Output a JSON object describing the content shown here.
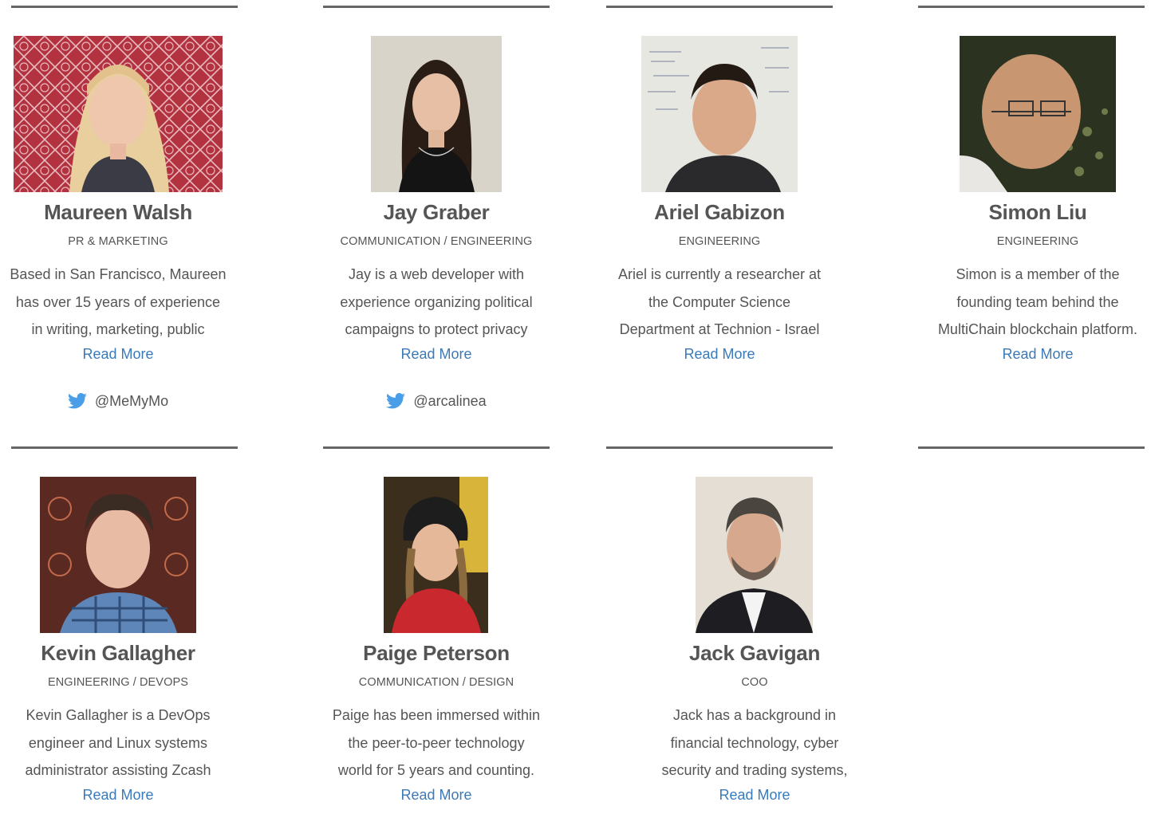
{
  "colors": {
    "text": "#555555",
    "link": "#3a7ab8",
    "rule": "#666666",
    "twitter": "#4a9ee8"
  },
  "team": [
    {
      "name": "Maureen Walsh",
      "role": "PR & MARKETING",
      "bio": [
        "Based in San Francisco, Maureen",
        "has over 15 years of experience",
        "in writing, marketing, public"
      ],
      "read_more": "Read More",
      "twitter": "@MeMyMo",
      "twitter_icon": "twitter-bird-icon"
    },
    {
      "name": "Jay Graber",
      "role": "COMMUNICATION / ENGINEERING",
      "bio": [
        "Jay is a web developer with",
        "experience organizing political",
        "campaigns to protect privacy"
      ],
      "read_more": "Read More",
      "twitter": "@arcalinea",
      "twitter_icon": "twitter-bird-icon"
    },
    {
      "name": "Ariel Gabizon",
      "role": "ENGINEERING",
      "bio": [
        "Ariel is currently a researcher at",
        "the Computer Science",
        "Department at Technion - Israel"
      ],
      "read_more": "Read More"
    },
    {
      "name": "Simon Liu",
      "role": "ENGINEERING",
      "bio": [
        "Simon is a member of the",
        "founding team behind the",
        "MultiChain blockchain platform."
      ],
      "read_more": "Read More"
    },
    {
      "name": "Kevin Gallagher",
      "role": "ENGINEERING / DEVOPS",
      "bio": [
        "Kevin Gallagher is a DevOps",
        "engineer and Linux systems",
        "administrator assisting Zcash"
      ],
      "read_more": "Read More"
    },
    {
      "name": "Paige Peterson",
      "role": "COMMUNICATION / DESIGN",
      "bio": [
        "Paige has been immersed within",
        "the peer-to-peer technology",
        "world for 5 years and counting."
      ],
      "read_more": "Read More"
    },
    {
      "name": "Jack Gavigan",
      "role": "COO",
      "bio": [
        "Jack has a background in",
        "financial technology, cyber",
        "security and trading systems,"
      ],
      "read_more": "Read More"
    }
  ]
}
